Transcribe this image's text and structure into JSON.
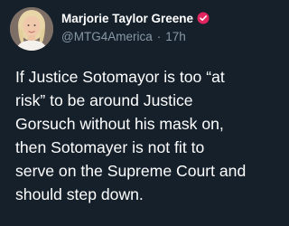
{
  "tweet": {
    "author": {
      "display_name": "Marjorie Taylor Greene",
      "handle": "@MTG4America",
      "verified_icon": "verified-badge-icon",
      "avatar_icon": "profile-photo"
    },
    "separator": "·",
    "time": "17h",
    "text_lines": [
      "If Justice Sotomayor is too “at",
      "risk” to be around Justice",
      "Gorsuch without his mask on,",
      "then Sotomayer is not fit to",
      "serve on the Supreme Court and",
      "should step down."
    ]
  },
  "colors": {
    "background": "#15202b",
    "primary_text": "#ffffff",
    "secondary_text": "#8899a6",
    "verified_badge": "#e0245e"
  }
}
